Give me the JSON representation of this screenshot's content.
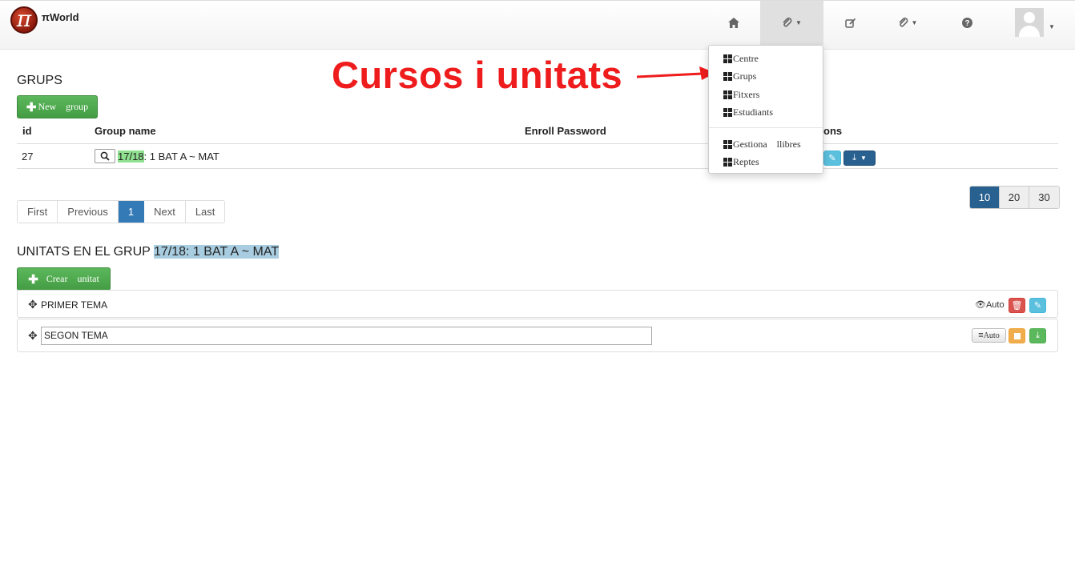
{
  "navbar": {
    "brand": "πWorld",
    "logo_glyph": "π",
    "icons": [
      "home-icon",
      "paperclip-icon",
      "edit-icon",
      "paperclip-icon",
      "help-icon",
      "avatar"
    ]
  },
  "dropdown": {
    "items": [
      "Centre",
      "Grups",
      "Fitxers",
      "Estudiants"
    ],
    "items2": [
      "Gestiona    llibres",
      "Reptes"
    ]
  },
  "annotation": {
    "text": "Cursos i unitats",
    "color": "#ee1c1c"
  },
  "groups": {
    "title": "GRUPS",
    "new_button": "New    group",
    "columns": [
      "id",
      "Group name",
      "Enroll Password",
      "ons"
    ],
    "rows": [
      {
        "id": "27",
        "name_prefix": "17/18",
        "name_rest": ": 1 BAT A ~ MAT"
      }
    ]
  },
  "pagination": {
    "pages": [
      "First",
      "Previous",
      "1",
      "Next",
      "Last"
    ],
    "active": "1",
    "sizes": [
      "10",
      "20",
      "30"
    ],
    "active_size": "10"
  },
  "units": {
    "title_prefix": "UNITATS EN EL GRUP",
    "title_group": "17/18: 1 BAT A ~ MAT",
    "create_button": "Crear    unitat",
    "items": [
      {
        "name": "PRIMER TEMA",
        "status": "Auto"
      },
      {
        "name": "SEGON TEMA",
        "status": "Auto"
      }
    ]
  },
  "colors": {
    "primary": "#337ab7",
    "success": "#5cb85c",
    "danger": "#d9534f",
    "info": "#5bc0de",
    "warning": "#f0ad4e"
  }
}
